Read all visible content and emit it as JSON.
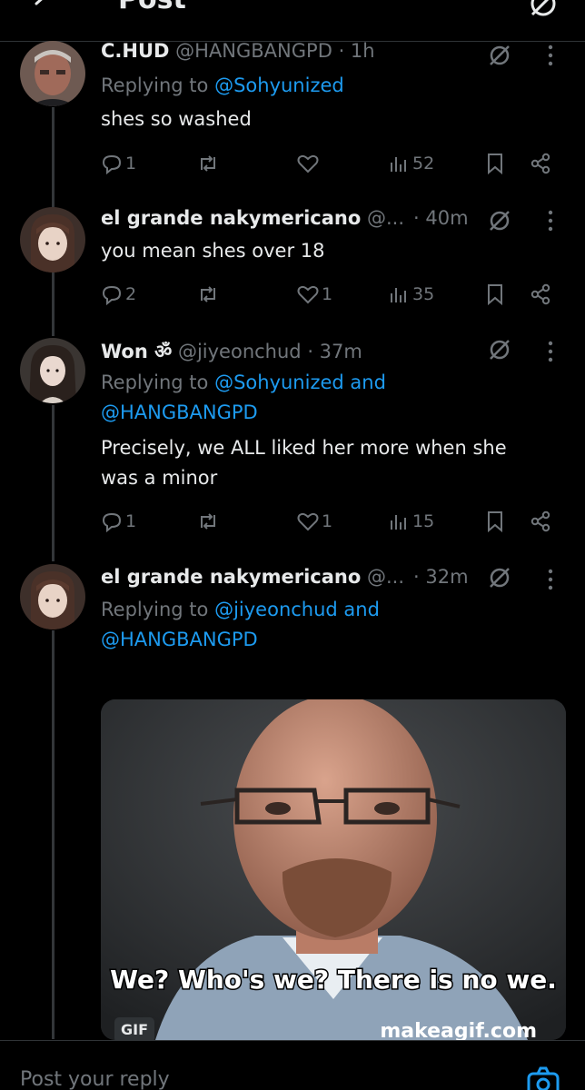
{
  "header": {
    "title": "Post"
  },
  "tweets": [
    {
      "name": "C.HUD",
      "handle": "@HANGBANGPD",
      "time": "· 1h",
      "replying_prefix": "Replying to ",
      "replying_to": [
        "@Sohyunized"
      ],
      "text": "shes so washed",
      "replies": "1",
      "reposts": "",
      "likes": "",
      "views": "52"
    },
    {
      "name": "el grande nakymericano",
      "handle": "@...",
      "time": "· 40m",
      "text": "you mean shes over 18",
      "replies": "2",
      "reposts": "",
      "likes": "1",
      "views": "35"
    },
    {
      "name": "Won ॐ",
      "handle": "@jiyeonchud",
      "time": "· 37m",
      "replying_prefix": "Replying to ",
      "replying_to": [
        "@Sohyunized",
        "@HANGBANGPD"
      ],
      "replying_and": " and",
      "text": "Precisely, we ALL liked her more when she was a minor",
      "replies": "1",
      "reposts": "",
      "likes": "1",
      "views": "15"
    },
    {
      "name": "el grande nakymericano",
      "handle": "@...",
      "time": "· 32m",
      "replying_prefix": "Replying to ",
      "replying_to": [
        "@jiyeonchud",
        "@HANGBANGPD"
      ],
      "replying_and": " and",
      "media": {
        "caption": "We? Who's we? There is no we.",
        "watermark": "makeagif.com",
        "badge": "GIF"
      }
    }
  ],
  "reply_bar": {
    "placeholder": "Post your reply"
  },
  "colors": {
    "background": "#000000",
    "text": "#e7e9ea",
    "muted": "#71767b",
    "accent": "#1d9bf0",
    "divider": "#2f3336"
  }
}
